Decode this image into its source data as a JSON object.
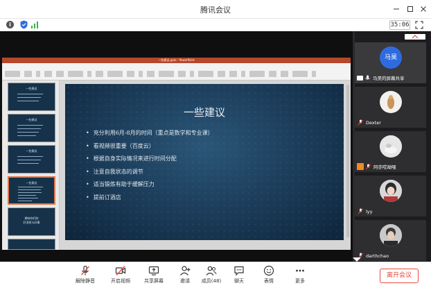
{
  "window": {
    "title": "腾讯会议",
    "timer": "35:06"
  },
  "info_icon_text": "i",
  "ppt": {
    "filename": "一些建议.pptx - PowerPoint",
    "thumbnails": [
      {
        "text": "一些建议"
      },
      {
        "text": "一些建议"
      },
      {
        "text": "一些建议"
      },
      {
        "text": "一些建议"
      },
      {
        "text": "期待你们的\n好消息与好事"
      },
      {
        "text": ""
      }
    ],
    "slide": {
      "title": "一些建议",
      "bullets": [
        "充分利用6月-8月的时间（重点是数学和专业课）",
        "看视频很重要（百度云）",
        "根据自身实际情况来进行时间分配",
        "注意自我状态的调节",
        "适当锻炼有助于缓解压力",
        "提前订酒店"
      ]
    }
  },
  "participants": [
    {
      "name": "马昊的屏幕共享",
      "avatar_text": "马昊",
      "avatar_color": "#2f6be0",
      "active": true
    },
    {
      "name": "Dexter",
      "avatar_text": ""
    },
    {
      "name": "阿亦哎呦喂",
      "avatar_text": ""
    },
    {
      "name": "lyy",
      "avatar_text": ""
    },
    {
      "name": "darthchao",
      "avatar_text": ""
    }
  ],
  "toolbar": {
    "items": [
      {
        "label": "解除静音",
        "icon": "mic-muted-icon"
      },
      {
        "label": "开启视频",
        "icon": "video-off-icon"
      },
      {
        "label": "共享屏幕",
        "icon": "share-screen-icon"
      },
      {
        "label": "邀请",
        "icon": "invite-icon"
      },
      {
        "label": "成员(48)",
        "icon": "members-icon"
      },
      {
        "label": "聊天",
        "icon": "chat-icon"
      },
      {
        "label": "表情",
        "icon": "emoji-icon"
      },
      {
        "label": "更多",
        "icon": "more-icon"
      }
    ],
    "leave_label": "离开会议"
  },
  "colors": {
    "accent_red": "#e64a3d",
    "ppt_red": "#b7472a",
    "avatar_blue": "#2f6be0"
  }
}
